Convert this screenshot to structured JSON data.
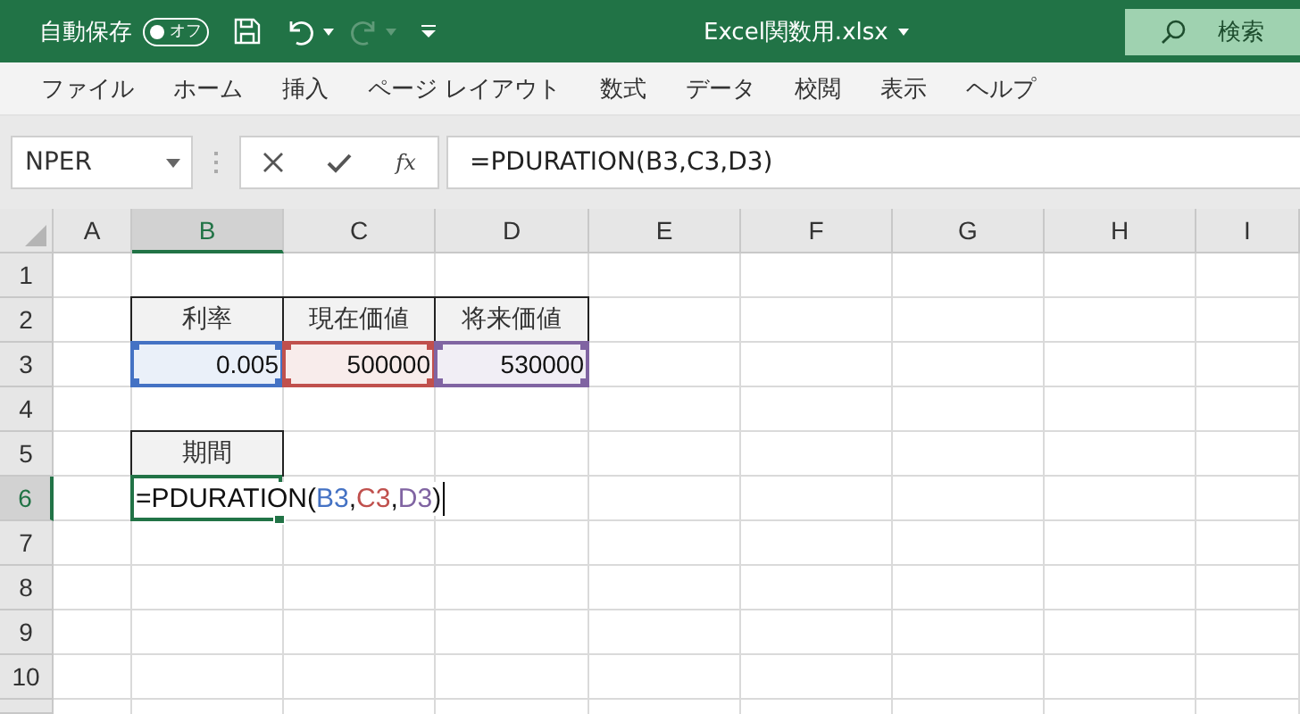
{
  "title_bar": {
    "autosave_label": "自動保存",
    "autosave_toggle": {
      "label": "オフ",
      "on": false
    },
    "file_title": "Excel関数用.xlsx",
    "search_label": "検索"
  },
  "ribbon_tabs": [
    "ファイル",
    "ホーム",
    "挿入",
    "ページ レイアウト",
    "数式",
    "データ",
    "校閲",
    "表示",
    "ヘルプ"
  ],
  "formula_bar": {
    "name_box": "NPER",
    "function_button": "fx",
    "formula": "=PDURATION(B3,C3,D3)"
  },
  "sheet": {
    "columns": [
      {
        "label": "A",
        "selected": false
      },
      {
        "label": "B",
        "selected": true
      },
      {
        "label": "C",
        "selected": false
      },
      {
        "label": "D",
        "selected": false
      },
      {
        "label": "E",
        "selected": false
      },
      {
        "label": "F",
        "selected": false
      },
      {
        "label": "G",
        "selected": false
      },
      {
        "label": "H",
        "selected": false
      },
      {
        "label": "I",
        "selected": false
      }
    ],
    "rows": [
      {
        "label": "1",
        "selected": false
      },
      {
        "label": "2",
        "selected": false,
        "cells": [
          null,
          {
            "kind": "header",
            "text": "利率"
          },
          {
            "kind": "header",
            "text": "現在価値"
          },
          {
            "kind": "header",
            "text": "将来価値"
          }
        ]
      },
      {
        "label": "3",
        "selected": false,
        "cells": [
          null,
          {
            "kind": "ref",
            "text": "0.005",
            "color": "#4472c4"
          },
          {
            "kind": "ref",
            "text": "500000",
            "color": "#c0504d"
          },
          {
            "kind": "ref",
            "text": "530000",
            "color": "#8064a2"
          }
        ]
      },
      {
        "label": "4",
        "selected": false
      },
      {
        "label": "5",
        "selected": false,
        "cells": [
          null,
          {
            "kind": "header",
            "text": "期間"
          }
        ]
      },
      {
        "label": "6",
        "selected": true,
        "cells": [
          null,
          {
            "kind": "formula",
            "active": true,
            "parts": [
              {
                "text": "=PDURATION("
              },
              {
                "text": "B3",
                "color": "#4472c4"
              },
              {
                "text": ","
              },
              {
                "text": "C3",
                "color": "#c0504d"
              },
              {
                "text": ","
              },
              {
                "text": "D3",
                "color": "#8064a2"
              },
              {
                "text": ")"
              }
            ]
          }
        ]
      },
      {
        "label": "7",
        "selected": false
      },
      {
        "label": "8",
        "selected": false
      },
      {
        "label": "9",
        "selected": false
      },
      {
        "label": "10",
        "selected": false
      }
    ]
  }
}
